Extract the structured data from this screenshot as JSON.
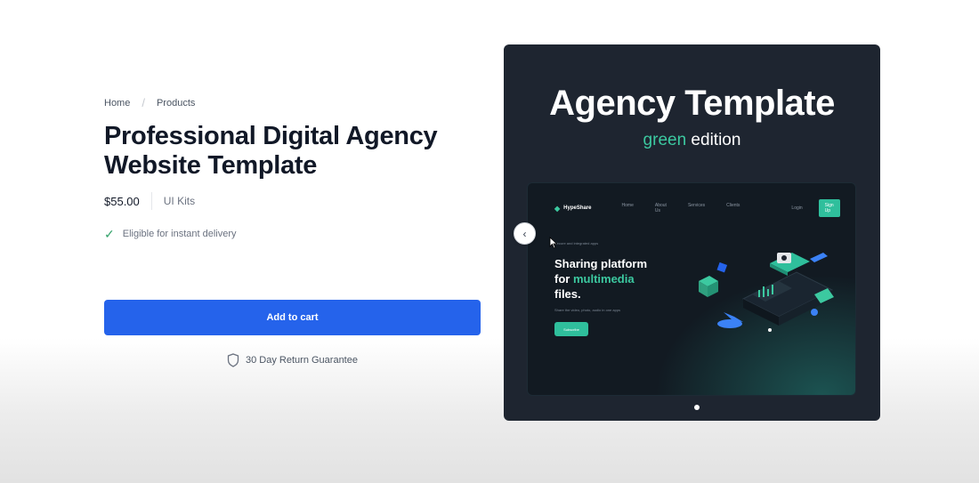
{
  "breadcrumb": {
    "items": [
      "Home",
      "Products"
    ],
    "separator": "/"
  },
  "product": {
    "title": "Professional Digital Agency Website Template",
    "price": "$55.00",
    "category": "UI Kits",
    "delivery": "Eligible for instant delivery",
    "add_to_cart": "Add to cart",
    "guarantee": "30 Day Return Guarantee"
  },
  "gallery": {
    "title": "Agency Template",
    "subtitle_accent": "green",
    "subtitle_rest": " edition",
    "mock": {
      "logo": "HypeShare",
      "nav": [
        "Home",
        "About Us",
        "Services",
        "Clients"
      ],
      "login": "Login",
      "signup": "Sign Up",
      "eyebrow": "Secure and integrated apps",
      "headline_1": "Sharing platform",
      "headline_2a": "for ",
      "headline_2b": "multimedia",
      "headline_3": "files.",
      "desc": "Share the video, photo, audio in one apps",
      "cta": "Subscribe"
    },
    "prev_icon": "chevron-left-icon",
    "page_indicator": "dot"
  },
  "colors": {
    "accent": "#2563eb",
    "green": "#3cc9a0",
    "card_bg": "#1e2530"
  }
}
